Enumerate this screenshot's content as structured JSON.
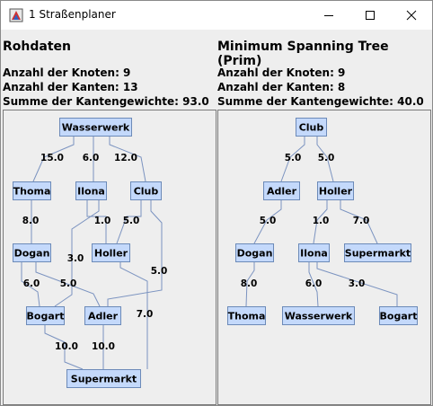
{
  "window": {
    "title": "1 Straßenplaner"
  },
  "left_panel": {
    "title": "Rohdaten",
    "stats": [
      "Anzahl der Knoten: 9",
      "Anzahl der Kanten: 13",
      "Summe der Kantengewichte: 93.0"
    ],
    "nodes": [
      "Wasserwerk",
      "Thoma",
      "Ilona",
      "Club",
      "Dogan",
      "Holler",
      "Bogart",
      "Adler",
      "Supermarkt"
    ],
    "edges": [
      {
        "from": "Wasserwerk",
        "to": "Thoma",
        "weight": "15.0"
      },
      {
        "from": "Wasserwerk",
        "to": "Ilona",
        "weight": "6.0"
      },
      {
        "from": "Wasserwerk",
        "to": "Club",
        "weight": "12.0"
      },
      {
        "from": "Thoma",
        "to": "Dogan",
        "weight": "8.0"
      },
      {
        "from": "Ilona",
        "to": "Holler",
        "weight": "1.0"
      },
      {
        "from": "Ilona",
        "to": "Bogart",
        "weight": "3.0"
      },
      {
        "from": "Club",
        "to": "Holler",
        "weight": "5.0"
      },
      {
        "from": "Club",
        "to": "Adler",
        "weight": "5.0"
      },
      {
        "from": "Dogan",
        "to": "Bogart",
        "weight": "6.0"
      },
      {
        "from": "Dogan",
        "to": "Adler",
        "weight": "5.0"
      },
      {
        "from": "Holler",
        "to": "Supermarkt",
        "weight": "7.0"
      },
      {
        "from": "Bogart",
        "to": "Supermarkt",
        "weight": "10.0"
      },
      {
        "from": "Adler",
        "to": "Supermarkt",
        "weight": "10.0"
      }
    ]
  },
  "right_panel": {
    "title": "Minimum Spanning Tree (Prim)",
    "stats": [
      "Anzahl der Knoten: 9",
      "Anzahl der Kanten: 8",
      "Summe der Kantengewichte: 40.0"
    ],
    "nodes": [
      "Club",
      "Adler",
      "Holler",
      "Dogan",
      "Ilona",
      "Supermarkt",
      "Thoma",
      "Wasserwerk",
      "Bogart"
    ],
    "edges": [
      {
        "from": "Club",
        "to": "Adler",
        "weight": "5.0"
      },
      {
        "from": "Club",
        "to": "Holler",
        "weight": "5.0"
      },
      {
        "from": "Adler",
        "to": "Dogan",
        "weight": "5.0"
      },
      {
        "from": "Holler",
        "to": "Ilona",
        "weight": "1.0"
      },
      {
        "from": "Holler",
        "to": "Supermarkt",
        "weight": "7.0"
      },
      {
        "from": "Dogan",
        "to": "Thoma",
        "weight": "8.0"
      },
      {
        "from": "Ilona",
        "to": "Wasserwerk",
        "weight": "6.0"
      },
      {
        "from": "Ilona",
        "to": "Bogart",
        "weight": "3.0"
      }
    ]
  },
  "colors": {
    "node_fill": "#c4d9fb",
    "node_border": "#6c8ab8",
    "edge": "#7b93c0"
  }
}
